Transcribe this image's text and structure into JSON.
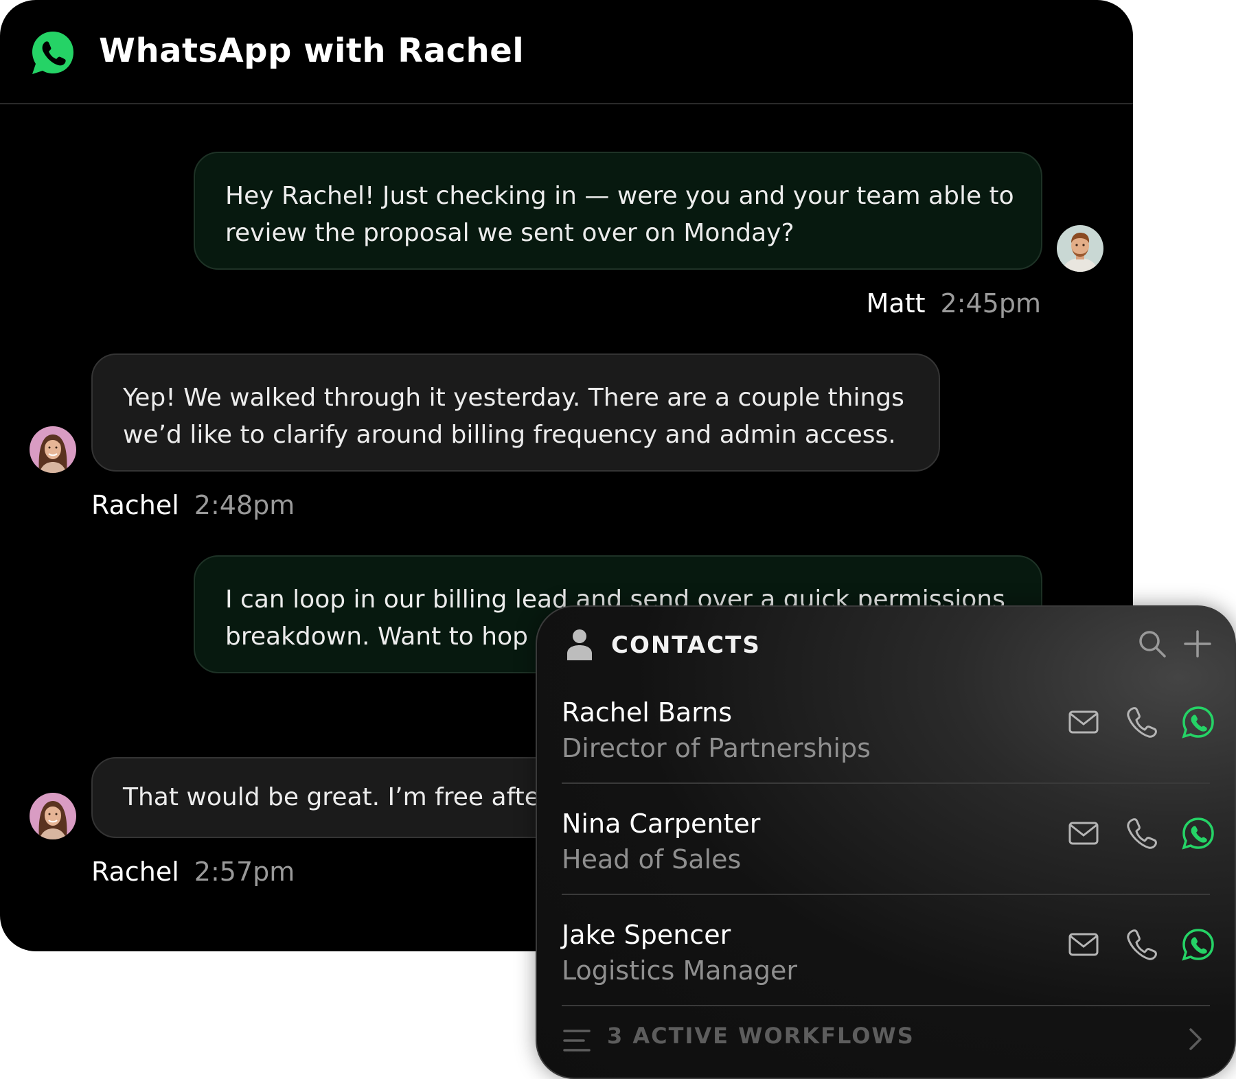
{
  "chat": {
    "title": "WhatsApp with Rachel",
    "messages": [
      {
        "direction": "outgoing",
        "lines": [
          "Hey Rachel! Just checking in — were you and your team able to",
          "review the proposal we sent over on Monday?"
        ],
        "sender": "Matt",
        "time": "2:45pm"
      },
      {
        "direction": "incoming",
        "lines": [
          "Yep! We walked through it yesterday. There are a couple things",
          "we’d like to clarify around billing frequency and admin access."
        ],
        "sender": "Rachel",
        "time": "2:48pm"
      },
      {
        "direction": "outgoing",
        "lines": [
          "I can loop in our billing lead and send over a quick permissions",
          "breakdown. Want to hop on a call"
        ],
        "sender": "",
        "time": ""
      },
      {
        "direction": "incoming",
        "lines": [
          "That would be great. I’m free afternoon"
        ],
        "sender": "Rachel",
        "time": "2:57pm"
      }
    ]
  },
  "contacts": {
    "title": "CONTACTS",
    "items": [
      {
        "name": "Rachel Barns",
        "role": "Director of Partnerships"
      },
      {
        "name": "Nina Carpenter",
        "role": "Head of Sales"
      },
      {
        "name": "Jake Spencer",
        "role": "Logistics Manager"
      }
    ],
    "footer": "3 ACTIVE WORKFLOWS"
  },
  "colors": {
    "whatsapp_green": "#25d366",
    "outgoing_bubble": "#07190f",
    "incoming_bubble": "#1b1b1b"
  },
  "icons": [
    "whatsapp-logo-icon",
    "person-icon",
    "search-icon",
    "plus-icon",
    "mail-icon",
    "phone-icon",
    "whatsapp-icon",
    "menu-lines-icon",
    "chevron-right-icon"
  ]
}
